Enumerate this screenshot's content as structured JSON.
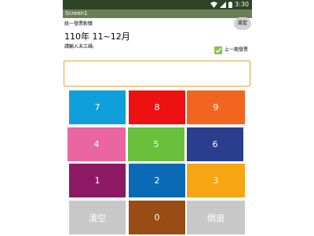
{
  "status_bar": {
    "time": "3:30"
  },
  "title_bar": {
    "title": "Screen1"
  },
  "header": {
    "app_name": "統一發票對獎",
    "settings_label": "設定"
  },
  "period": "110年 11~12月",
  "prompt": "請輸入末三碼:",
  "checkbox": {
    "label": "上一期發票",
    "checked": true
  },
  "input": {
    "value": ""
  },
  "keypad": {
    "keys": [
      {
        "label": "7",
        "color": "#0fa0dc"
      },
      {
        "label": "8",
        "color": "#ee1111"
      },
      {
        "label": "9",
        "color": "#f26520"
      },
      {
        "label": "4",
        "color": "#e966a0"
      },
      {
        "label": "5",
        "color": "#6abf3d"
      },
      {
        "label": "6",
        "color": "#2b3e8e"
      },
      {
        "label": "1",
        "color": "#8d1964"
      },
      {
        "label": "2",
        "color": "#0a6ab5"
      },
      {
        "label": "3",
        "color": "#f6a613"
      },
      {
        "label": "清空",
        "color": "#c8c8c8"
      },
      {
        "label": "0",
        "color": "#994c13"
      },
      {
        "label": "倒退",
        "color": "#c8c8c8"
      }
    ]
  },
  "colors": {
    "status_bar": "#2f4426",
    "title_bar": "#6b7f55",
    "checkbox": "#8bc34a",
    "input_border": "#f0a030"
  }
}
